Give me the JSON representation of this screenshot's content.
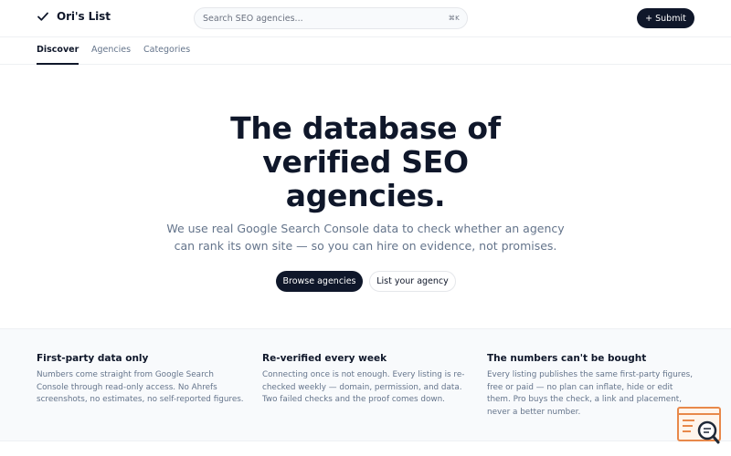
{
  "header": {
    "logo_text": "Ori's List",
    "search_placeholder": "Search SEO agencies...",
    "search_shortcut": "⌘K",
    "submit_label": "+ Submit"
  },
  "tabs": [
    {
      "label": "Discover",
      "active": true
    },
    {
      "label": "Agencies",
      "active": false
    },
    {
      "label": "Categories",
      "active": false
    }
  ],
  "hero": {
    "title_lines": [
      "The database of",
      "verified SEO",
      "agencies."
    ],
    "subtitle_lines": [
      "We use real Google Search Console data to check whether an agency",
      "can rank its own site — so you can hire on evidence, not promises."
    ],
    "primary_button": "Browse agencies",
    "secondary_button": "List your agency"
  },
  "features": [
    {
      "title": "First-party data only",
      "body_lines": [
        "Numbers come straight from Google Search",
        "Console through read-only access. No Ahrefs",
        "screenshots, no estimates, no self-reported figures."
      ]
    },
    {
      "title": "Re-verified every week",
      "body_lines": [
        "Connecting once is not enough. Every listing is re-",
        "checked weekly — domain, permission, and data.",
        "Two failed checks and the proof comes down."
      ]
    },
    {
      "title": "The numbers can't be bought",
      "body_lines": [
        "Every listing publishes the same first-party figures,",
        "free or paid — no plan can inflate, hide or edit",
        "them. Pro buys the check, a link and placement,",
        "never a better number."
      ]
    }
  ],
  "colors": {
    "primary": "#0f172a",
    "muted_text": "#64748b",
    "feature_bg": "#f8fafc",
    "badge_accent": "#e8884a"
  },
  "icons": {
    "logo": "check-icon",
    "badge": "search-document-icon"
  }
}
